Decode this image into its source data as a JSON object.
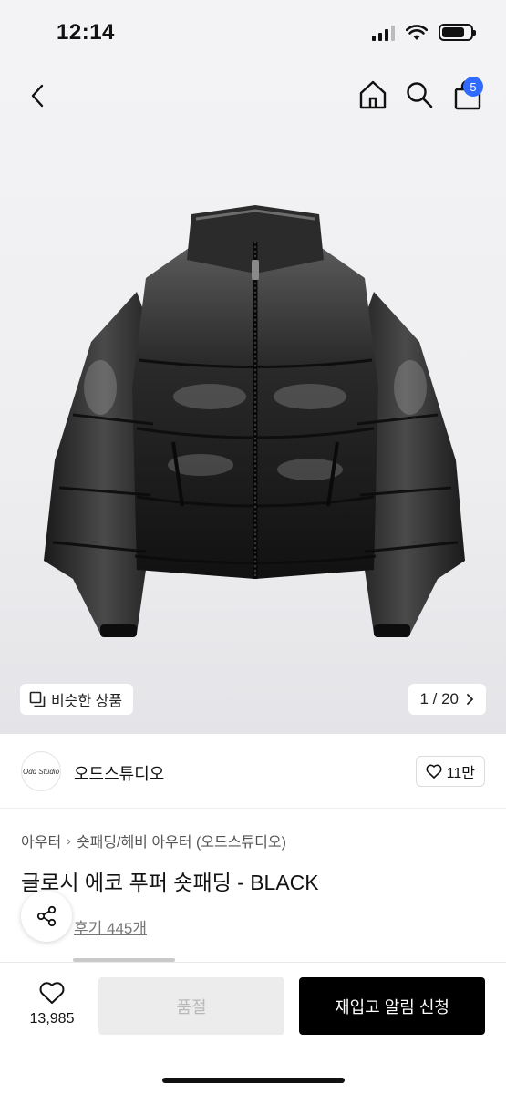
{
  "status_bar": {
    "time": "12:14"
  },
  "nav": {
    "cart_count": "5"
  },
  "gallery": {
    "similar_label": "비슷한 상품",
    "page_indicator": "1 / 20"
  },
  "brand": {
    "logo_text": "Odd Studio",
    "name": "오드스튜디오",
    "likes": "11만"
  },
  "breadcrumb": [
    {
      "label": "아우터"
    },
    {
      "label": "숏패딩/헤비 아우터 (오드스튜디오)"
    }
  ],
  "product": {
    "title": "글로시 에코 푸퍼 숏패딩 - BLACK",
    "review_link": "후기 445개"
  },
  "bottom_bar": {
    "wish_count": "13,985",
    "soldout_label": "품절",
    "restock_label": "재입고 알림 신청"
  },
  "colors": {
    "badge": "#2f6bff",
    "primary_button": "#000000",
    "disabled_button": "#ececec"
  }
}
